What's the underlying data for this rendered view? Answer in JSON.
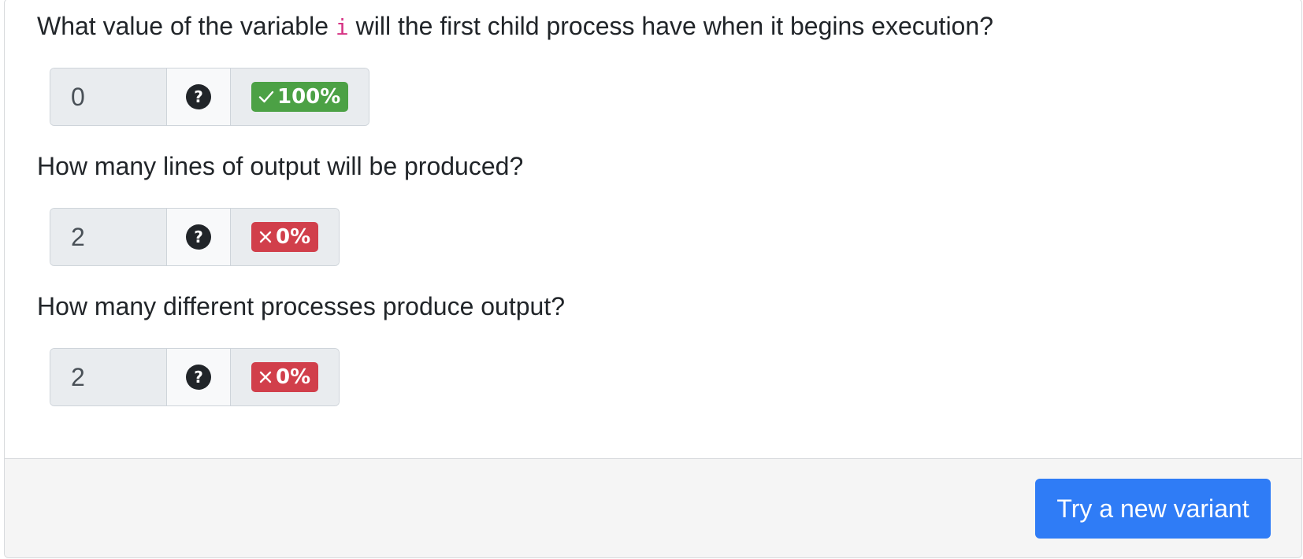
{
  "questions": [
    {
      "text_before": "What value of the variable ",
      "code": "i",
      "text_after": " will the first child process have when it begins execution?",
      "answer": "0",
      "score": "100%",
      "status": "correct"
    },
    {
      "text": "How many lines of output will be produced?",
      "answer": "2",
      "score": "0%",
      "status": "incorrect"
    },
    {
      "text": "How many different processes produce output?",
      "answer": "2",
      "score": "0%",
      "status": "incorrect"
    }
  ],
  "help_icon": "?",
  "footer": {
    "button_label": "Try a new variant"
  },
  "colors": {
    "correct": "#4ca145",
    "incorrect": "#d13f4b",
    "primary": "#2f7cf6",
    "code": "#d63384"
  },
  "icons": {
    "help": "question-circle-icon",
    "correct": "check-icon",
    "incorrect": "x-icon"
  }
}
